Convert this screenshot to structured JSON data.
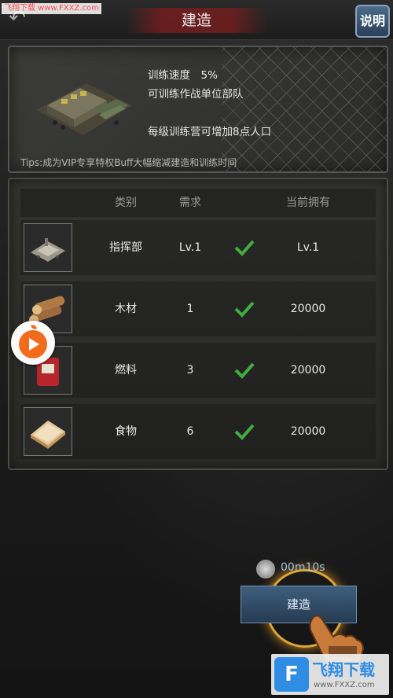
{
  "watermark_top": "飞翔下载 www.FXXZ.com",
  "header": {
    "title": "建造",
    "help_label": "说明"
  },
  "info": {
    "lines": [
      "训练速度　5%",
      "可训练作战单位部队",
      "每级训练营可增加8点人口"
    ],
    "tips": "Tips:成为VIP专享特权Buff大幅缩减建造和训练时间"
  },
  "requirements": {
    "headers": {
      "category": "类别",
      "required": "需求",
      "owned": "当前拥有"
    },
    "rows": [
      {
        "name": "指挥部",
        "required": "Lv.1",
        "owned": "Lv.1",
        "icon": "headquarters-icon"
      },
      {
        "name": "木材",
        "required": "1",
        "owned": "20000",
        "icon": "wood-icon"
      },
      {
        "name": "燃料",
        "required": "3",
        "owned": "20000",
        "icon": "fuel-icon"
      },
      {
        "name": "食物",
        "required": "6",
        "owned": "20000",
        "icon": "food-icon"
      }
    ]
  },
  "build": {
    "timer": "00m10s",
    "button_label": "建造"
  },
  "watermark_bottom": {
    "logo": "F",
    "name": "飞翔下载",
    "url": "www.FXXZ.com"
  },
  "colors": {
    "title_banner": "#6e1e1e",
    "check": "#3fae3f",
    "build_button": "#3f5e7c",
    "timer_text": "#9cc6e6"
  }
}
